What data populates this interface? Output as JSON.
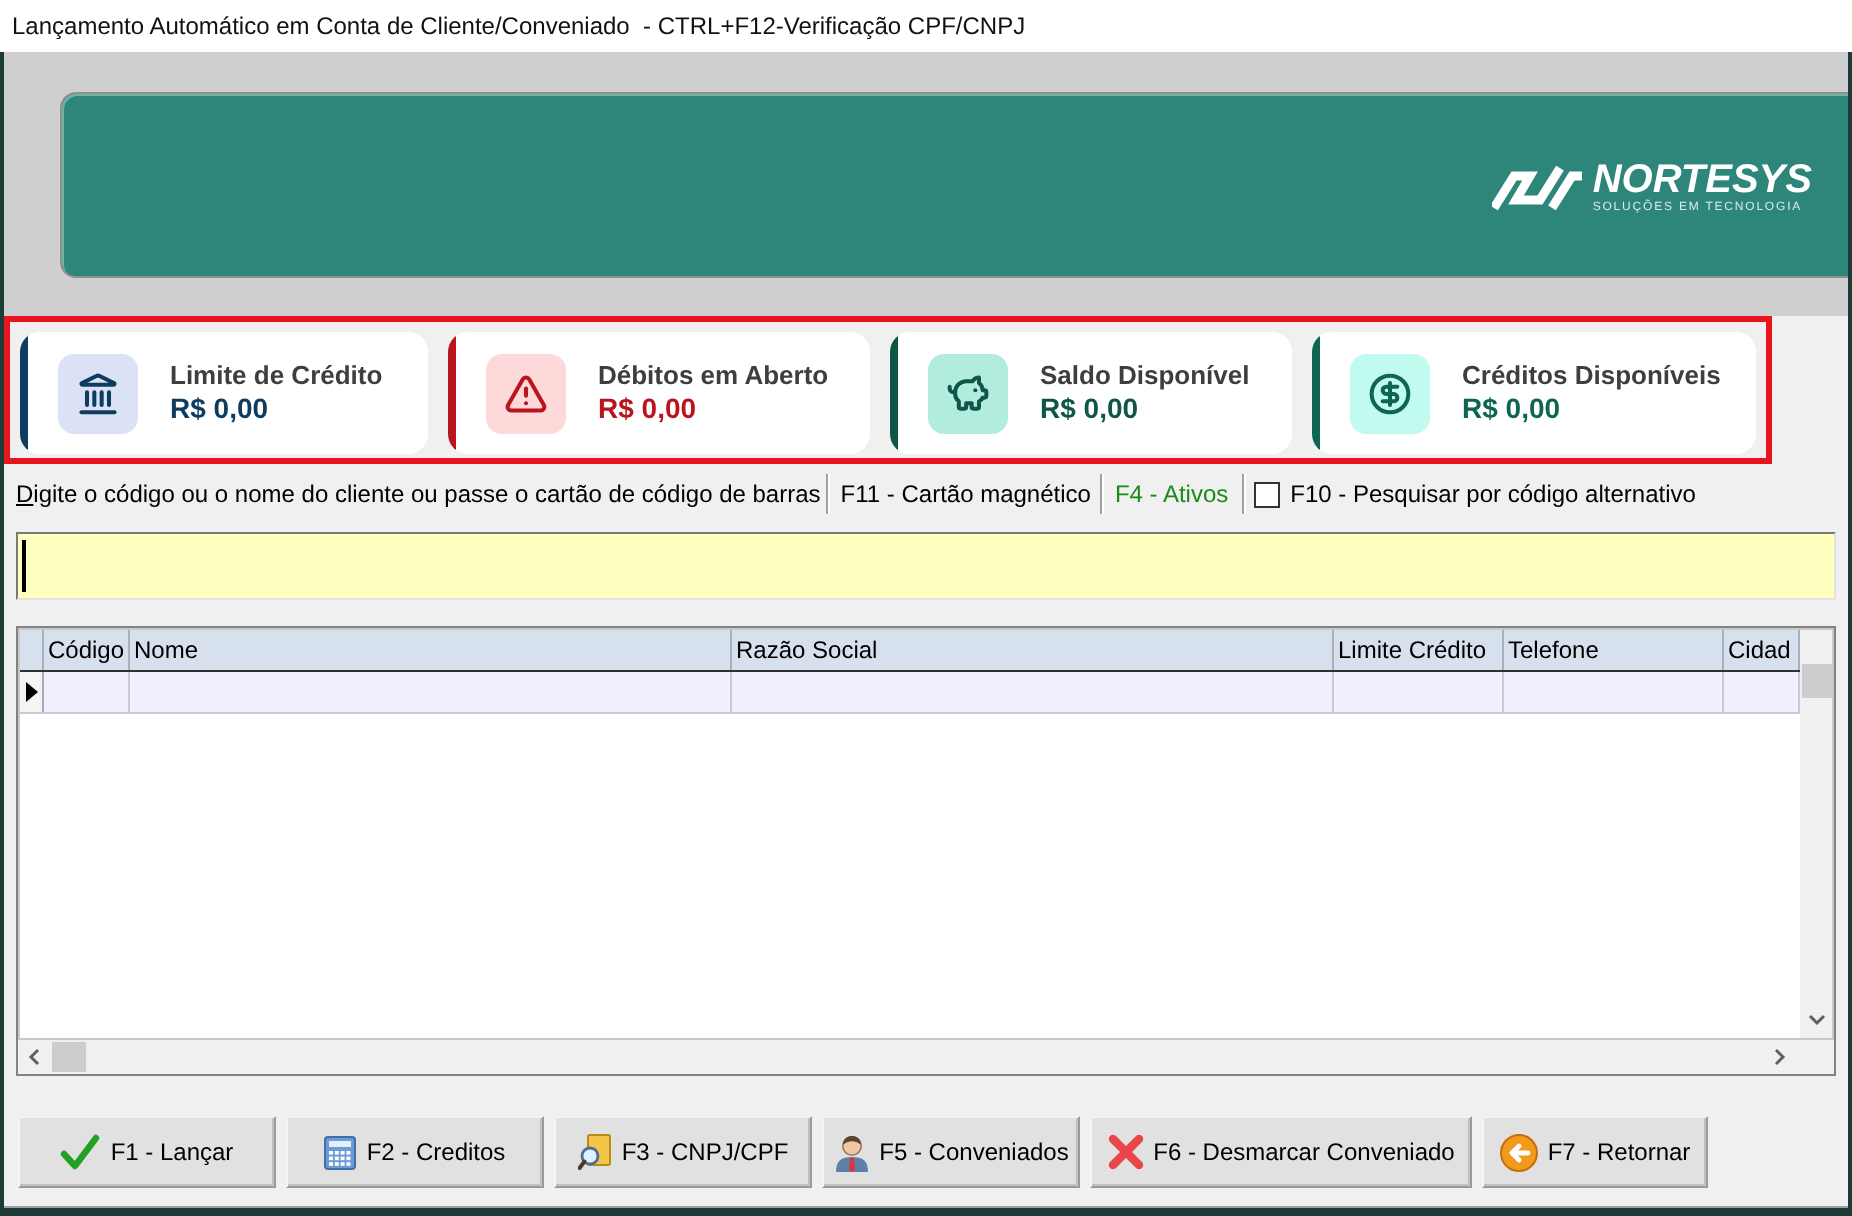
{
  "window": {
    "title": "Lançamento Automático em Conta de Cliente/Conveniado  - CTRL+F12-Verificação CPF/CNPJ"
  },
  "banner": {
    "logo": {
      "name": "NORTESYS",
      "tagline": "SOLUÇÕES EM TECNOLOGIA"
    }
  },
  "summary": {
    "highlighted": true,
    "cards": [
      {
        "kind": "bank",
        "label": "Limite de Crédito",
        "value": "R$ 0,00",
        "color": "#0d3c5e"
      },
      {
        "kind": "warning",
        "label": "Débitos em Aberto",
        "value": "R$ 0,00",
        "color": "#b8161c"
      },
      {
        "kind": "piggy",
        "label": "Saldo Disponível",
        "value": "R$ 0,00",
        "color": "#0f5646"
      },
      {
        "kind": "dollar",
        "label": "Créditos Disponíveis",
        "value": "R$ 0,00",
        "color": "#0e6650"
      }
    ]
  },
  "search": {
    "label": "Digite o código ou o nome do cliente ou passe o cartão de código de barras",
    "options": [
      {
        "label": "F11 - Cartão magnético",
        "color": "#000000"
      },
      {
        "label": "F4 - Ativos",
        "color": "#1a8a1a"
      }
    ],
    "alt_code": {
      "label": "F10 - Pesquisar por código alternativo",
      "checked": false
    }
  },
  "grid": {
    "columns": [
      "Código",
      "Nome",
      "Razão Social",
      "Limite Crédito",
      "Telefone",
      "Cidad"
    ],
    "rows": [
      {
        "selected": true
      }
    ]
  },
  "buttons": [
    {
      "kind": "check",
      "label": "F1 - Lançar"
    },
    {
      "kind": "calculator",
      "label": "F2 - Creditos"
    },
    {
      "kind": "search-card",
      "label": "F3 - CNPJ/CPF"
    },
    {
      "kind": "person",
      "label": "F5 - Conveniados"
    },
    {
      "kind": "cross",
      "label": "F6 - Desmarcar Conveniado"
    },
    {
      "kind": "back",
      "label": "F7 - Retornar"
    }
  ]
}
